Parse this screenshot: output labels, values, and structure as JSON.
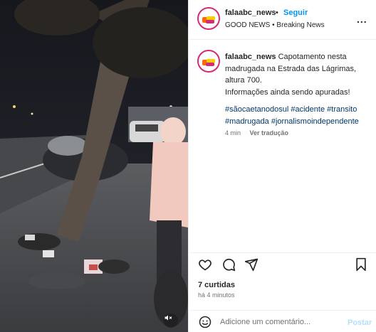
{
  "header": {
    "username": "falaabc_news",
    "separator": "•",
    "follow_label": "Seguir",
    "subtitle": "GOOD NEWS • Breaking News",
    "more": "..."
  },
  "caption": {
    "username": "falaabc_news",
    "text": "Capotamento nesta madrugada na Estrada das Lágrimas, altura 700.",
    "text2": "Informações ainda sendo apuradas!",
    "hashtags": [
      "#sãocaetanodosul",
      "#acidente",
      "#transito",
      "#madrugada",
      "#jornalismoindependente"
    ],
    "time": "4 min",
    "translate": "Ver tradução"
  },
  "stats": {
    "likes": "7 curtidas",
    "time_ago": "há 4 minutos"
  },
  "comment": {
    "placeholder": "Adicione um comentário...",
    "post_label": "Postar"
  },
  "icons": {
    "like": "heart-icon",
    "comment": "comment-icon",
    "share": "share-icon",
    "save": "bookmark-icon",
    "emoji": "emoji-icon",
    "mute": "speaker-muted-icon"
  },
  "colors": {
    "accent_blue": "#0095f6",
    "hashtag": "#00376b",
    "muted_text": "#737373",
    "post_disabled": "#b2dffc",
    "avatar_ring": "#d62976"
  }
}
